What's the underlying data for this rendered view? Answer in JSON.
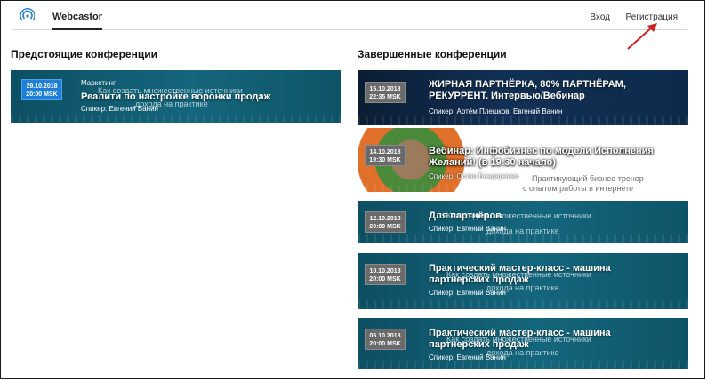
{
  "header": {
    "brand": "Webcastor",
    "login": "Вход",
    "register": "Регистрация"
  },
  "upcoming": {
    "title": "Предстоящие конференции",
    "cards": [
      {
        "date": "29.10.2018",
        "time": "20:00 MSK",
        "category": "Маркетинг",
        "title": "Реалити по настройке воронки продаж",
        "speaker": "Спикер: Евгений Ванин",
        "ghost1": "Как создать множественные источники",
        "ghost2": "дохода на практике"
      }
    ]
  },
  "completed": {
    "title": "Завершенные конференции",
    "cards": [
      {
        "date": "15.10.2018",
        "time": "22:35 MSK",
        "title": "ЖИРНАЯ ПАРТНЁРКА, 80% ПАРТНЁРАМ, РЕКУРРЕНТ. Интервью/Вебинар",
        "speaker": "Спикер: Артём Плешков, Евгений Ванин"
      },
      {
        "date": "14.10.2018",
        "time": "19:30 MSK",
        "title": "Вебинар: Инфобизнес по модели Исполнения Желаний! (в 19:30 начало)",
        "speaker": "Спикер: Остап Бондаренко",
        "ghost1": "Практикующий бизнес-тренер",
        "ghost2": "с опытом работы в интернете"
      },
      {
        "date": "12.10.2018",
        "time": "20:00 MSK",
        "title": "Для партнёров",
        "speaker": "Спикер: Евгений Ванин",
        "ghost1": "Как создать множественные источники",
        "ghost2": "дохода на практике"
      },
      {
        "date": "10.10.2018",
        "time": "20:00 MSK",
        "title": "Практический мастер-класс - машина партнерских продаж",
        "speaker": "Спикер: Евгений Ванин",
        "ghost1": "Как создать множественные источники",
        "ghost2": "дохода на практике"
      },
      {
        "date": "05.10.2018",
        "time": "20:00 MSK",
        "title": "Практический мастер-класс - машина партнерских продаж",
        "speaker": "Спикер: Евгений Ванин",
        "ghost1": "Как создать множественные источники",
        "ghost2": "дохода на практике"
      }
    ]
  },
  "colors": {
    "accent": "#1f7fd8",
    "card_bg": "#14667d",
    "arrow": "#cc2222"
  }
}
